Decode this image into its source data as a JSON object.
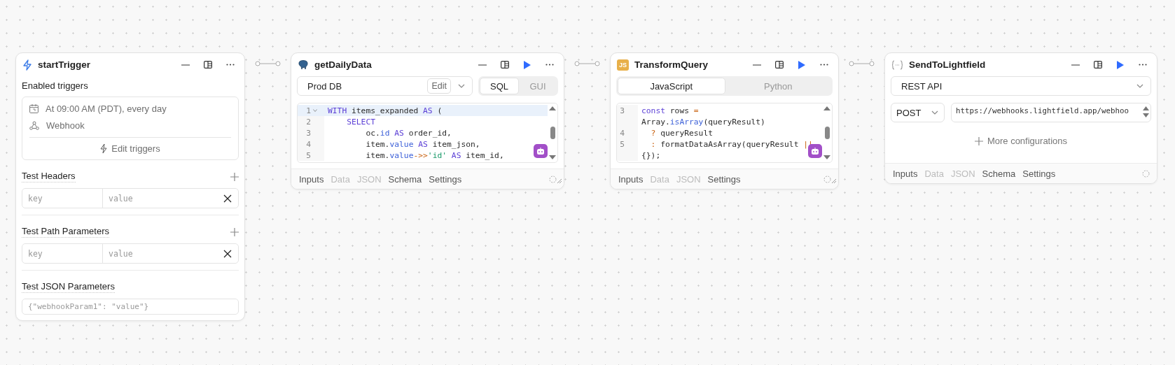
{
  "nodes": [
    {
      "kind": "trigger",
      "title": "startTrigger",
      "runnable": false,
      "enabled_label": "Enabled triggers",
      "triggers": [
        {
          "kind": "schedule",
          "text": "At 09:00 AM (PDT), every day"
        },
        {
          "kind": "webhook",
          "text": "Webhook"
        }
      ],
      "edit_button": "Edit triggers",
      "param_groups": [
        {
          "title": "Test Headers",
          "rows": [
            {
              "key_placeholder": "key",
              "value_placeholder": "value"
            }
          ]
        },
        {
          "title": "Test Path Parameters",
          "rows": [
            {
              "key_placeholder": "key",
              "value_placeholder": "value"
            }
          ]
        }
      ],
      "json_params": {
        "title": "Test JSON Parameters",
        "placeholder": "{\"webhookParam1\": \"value\"}"
      }
    },
    {
      "kind": "query",
      "title": "getDailyData",
      "runnable": true,
      "resource": "Prod DB",
      "edit_button": "Edit",
      "modes": [
        {
          "label": "SQL",
          "selected": true
        },
        {
          "label": "GUI",
          "selected": false
        }
      ],
      "code": [
        {
          "number": "1",
          "active": true,
          "foldable": true,
          "tokens": [
            {
              "kind": "kw",
              "text": "WITH"
            },
            {
              "kind": "t",
              "text": " items_expanded "
            },
            {
              "kind": "kw",
              "text": "AS"
            },
            {
              "kind": "t",
              "text": " ("
            }
          ]
        },
        {
          "number": "2",
          "active": false,
          "foldable": false,
          "tokens": [
            {
              "kind": "kw",
              "text": "    SELECT"
            }
          ]
        },
        {
          "number": "3",
          "active": false,
          "foldable": false,
          "tokens": [
            {
              "kind": "t",
              "text": "        oc."
            },
            {
              "kind": "prop",
              "text": "id"
            },
            {
              "kind": "kw",
              "text": " AS"
            },
            {
              "kind": "t",
              "text": " order_id,"
            }
          ]
        },
        {
          "number": "4",
          "active": false,
          "foldable": false,
          "tokens": [
            {
              "kind": "t",
              "text": "        item."
            },
            {
              "kind": "prop",
              "text": "value"
            },
            {
              "kind": "kw",
              "text": " AS"
            },
            {
              "kind": "t",
              "text": " item_json,"
            }
          ]
        },
        {
          "number": "5",
          "active": false,
          "foldable": false,
          "tokens": [
            {
              "kind": "t",
              "text": "        item."
            },
            {
              "kind": "prop",
              "text": "value"
            },
            {
              "kind": "op",
              "text": "->>"
            },
            {
              "kind": "str",
              "text": "'id'"
            },
            {
              "kind": "kw",
              "text": " AS"
            },
            {
              "kind": "t",
              "text": " item_id,"
            }
          ]
        }
      ],
      "tabs": [
        {
          "label": "Inputs",
          "disabled": false
        },
        {
          "label": "Data",
          "disabled": true
        },
        {
          "label": "JSON",
          "disabled": true
        },
        {
          "label": "Schema",
          "disabled": false
        },
        {
          "label": "Settings",
          "disabled": false
        }
      ],
      "resizable": true
    },
    {
      "kind": "transform",
      "badge": "JS",
      "title": "TransformQuery",
      "runnable": true,
      "modes": [
        {
          "label": "JavaScript",
          "selected": true
        },
        {
          "label": "Python",
          "selected": false
        }
      ],
      "code": [
        {
          "number": "3",
          "active": false,
          "foldable": false,
          "tokens": [
            {
              "kind": "kw",
              "text": "const"
            },
            {
              "kind": "t",
              "text": " rows "
            },
            {
              "kind": "op",
              "text": "="
            }
          ]
        },
        {
          "active": false,
          "foldable": false,
          "tokens": [
            {
              "kind": "t",
              "text": "Array."
            },
            {
              "kind": "prop",
              "text": "isArray"
            },
            {
              "kind": "t",
              "text": "(queryResult)"
            }
          ]
        },
        {
          "number": "4",
          "active": false,
          "foldable": false,
          "tokens": [
            {
              "kind": "op",
              "text": "  ?"
            },
            {
              "kind": "t",
              "text": " queryResult"
            }
          ]
        },
        {
          "number": "5",
          "active": false,
          "foldable": false,
          "tokens": [
            {
              "kind": "op",
              "text": "  :"
            },
            {
              "kind": "t",
              "text": " formatDataAsArray(queryResult "
            },
            {
              "kind": "op",
              "text": "||"
            }
          ]
        },
        {
          "active": false,
          "foldable": false,
          "tokens": [
            {
              "kind": "t",
              "text": "{});"
            }
          ]
        }
      ],
      "tabs": [
        {
          "label": "Inputs",
          "disabled": false
        },
        {
          "label": "Data",
          "disabled": true
        },
        {
          "label": "JSON",
          "disabled": true
        },
        {
          "label": "Settings",
          "disabled": false
        }
      ],
      "resizable": true
    },
    {
      "kind": "request",
      "title": "SendToLightfield",
      "runnable": true,
      "resource": "REST API",
      "method": "POST",
      "url": "https://webhooks.lightfield.app/webhoo",
      "more_button": "More configurations",
      "tabs": [
        {
          "label": "Inputs",
          "disabled": false
        },
        {
          "label": "Data",
          "disabled": true
        },
        {
          "label": "JSON",
          "disabled": true
        },
        {
          "label": "Schema",
          "disabled": false
        },
        {
          "label": "Settings",
          "disabled": false
        }
      ],
      "resizable": false
    }
  ]
}
